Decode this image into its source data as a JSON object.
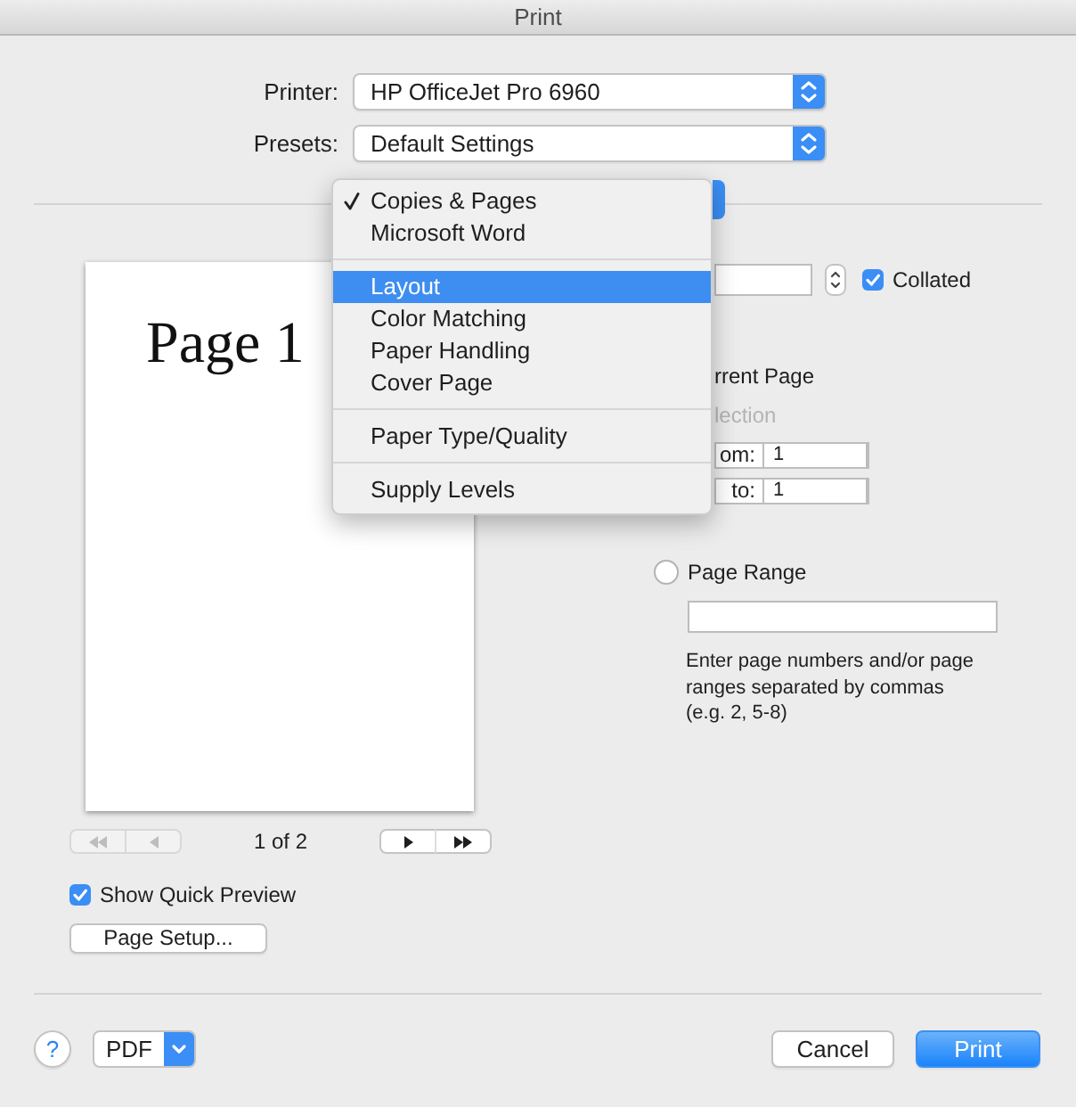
{
  "window": {
    "title": "Print"
  },
  "printer": {
    "label": "Printer:",
    "value": "HP OfficeJet Pro 6960"
  },
  "presets": {
    "label": "Presets:",
    "value": "Default Settings"
  },
  "section_menu": {
    "groups": [
      {
        "items": [
          {
            "label": "Copies & Pages",
            "checked": true,
            "selected": false
          },
          {
            "label": "Microsoft Word",
            "checked": false,
            "selected": false
          }
        ]
      },
      {
        "items": [
          {
            "label": "Layout",
            "checked": false,
            "selected": true
          },
          {
            "label": "Color Matching",
            "checked": false,
            "selected": false
          },
          {
            "label": "Paper Handling",
            "checked": false,
            "selected": false
          },
          {
            "label": "Cover Page",
            "checked": false,
            "selected": false
          }
        ]
      },
      {
        "items": [
          {
            "label": "Paper Type/Quality",
            "checked": false,
            "selected": false
          }
        ]
      },
      {
        "items": [
          {
            "label": "Supply Levels",
            "checked": false,
            "selected": false
          }
        ]
      }
    ]
  },
  "preview": {
    "page_text": "Page 1",
    "page_counter": "1 of 2",
    "nav_buttons": [
      {
        "kind": "first",
        "disabled": true
      },
      {
        "kind": "previous",
        "disabled": true
      },
      {
        "kind": "next",
        "disabled": false
      },
      {
        "kind": "last",
        "disabled": false
      }
    ]
  },
  "show_quick_preview": {
    "label": "Show Quick Preview",
    "checked": true
  },
  "page_setup_button": {
    "label": "Page Setup..."
  },
  "copies": {
    "collated": {
      "label": "Collated",
      "checked": true
    }
  },
  "pages": {
    "options": [
      {
        "kind": "text",
        "label": "rrent Page",
        "disabled": false
      },
      {
        "kind": "text",
        "label": "lection",
        "disabled": true
      },
      {
        "kind": "field",
        "label": "om:",
        "value": "1"
      },
      {
        "kind": "field",
        "label": "to:",
        "value": "1"
      }
    ],
    "page_range": {
      "label": "Page Range",
      "selected": false,
      "hint_lines": [
        "Enter page numbers and/or page",
        "ranges separated by commas",
        "(e.g. 2, 5-8)"
      ]
    }
  },
  "footer": {
    "help_button": {
      "label": "?"
    },
    "pdf_button": {
      "label": "PDF"
    },
    "buttons": [
      {
        "kind": "cancel",
        "label": "Cancel"
      },
      {
        "kind": "default",
        "label": "Print"
      }
    ]
  }
}
